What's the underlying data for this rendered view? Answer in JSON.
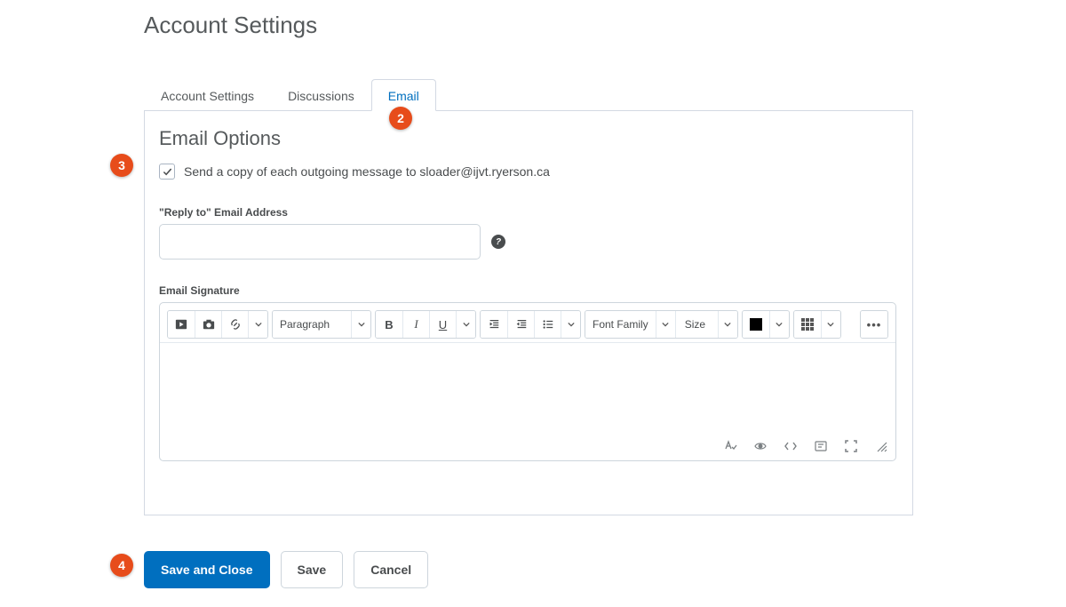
{
  "page_title": "Account Settings",
  "tabs": [
    {
      "label": "Account Settings",
      "active": false
    },
    {
      "label": "Discussions",
      "active": false
    },
    {
      "label": "Email",
      "active": true
    }
  ],
  "section_heading": "Email Options",
  "send_copy": {
    "checked": true,
    "label": "Send a copy of each outgoing message to sloader@ijvt.ryerson.ca"
  },
  "reply_to": {
    "label": "\"Reply to\" Email Address",
    "value": ""
  },
  "signature": {
    "label": "Email Signature"
  },
  "editor": {
    "paragraph_label": "Paragraph",
    "font_family_label": "Font Family",
    "size_label": "Size"
  },
  "actions": {
    "save_and_close": "Save and Close",
    "save": "Save",
    "cancel": "Cancel"
  },
  "annotations": {
    "a2": "2",
    "a3": "3",
    "a4": "4"
  }
}
